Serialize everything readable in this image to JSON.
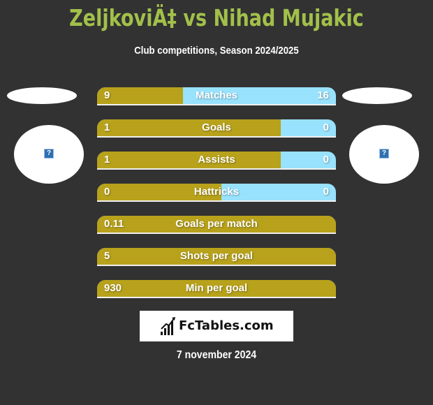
{
  "header": {
    "title": "ZeljkoviÄ‡ vs Nihad Mujakic",
    "subtitle": "Club competitions, Season 2024/2025"
  },
  "players": {
    "left": {
      "avatar_icon": "broken-image-icon",
      "avatar_glyph": "?"
    },
    "right": {
      "avatar_icon": "broken-image-icon",
      "avatar_glyph": "?"
    }
  },
  "colors": {
    "background": "#323232",
    "title": "#a2c04a",
    "left_bar": "#b8a21b",
    "right_bar": "#98e2fd"
  },
  "stats": [
    {
      "label": "Matches",
      "left": "9",
      "right": "16",
      "left_share": 0.36
    },
    {
      "label": "Goals",
      "left": "1",
      "right": "0",
      "left_share": 0.77
    },
    {
      "label": "Assists",
      "left": "1",
      "right": "0",
      "left_share": 0.77
    },
    {
      "label": "Hattricks",
      "left": "0",
      "right": "0",
      "left_share": 0.52
    },
    {
      "label": "Goals per match",
      "left": "0.11",
      "right": "",
      "left_share": 1.0
    },
    {
      "label": "Shots per goal",
      "left": "5",
      "right": "",
      "left_share": 1.0
    },
    {
      "label": "Min per goal",
      "left": "930",
      "right": "",
      "left_share": 1.0
    }
  ],
  "footer": {
    "logo_text": "FcTables.com",
    "date": "7 november 2024"
  }
}
